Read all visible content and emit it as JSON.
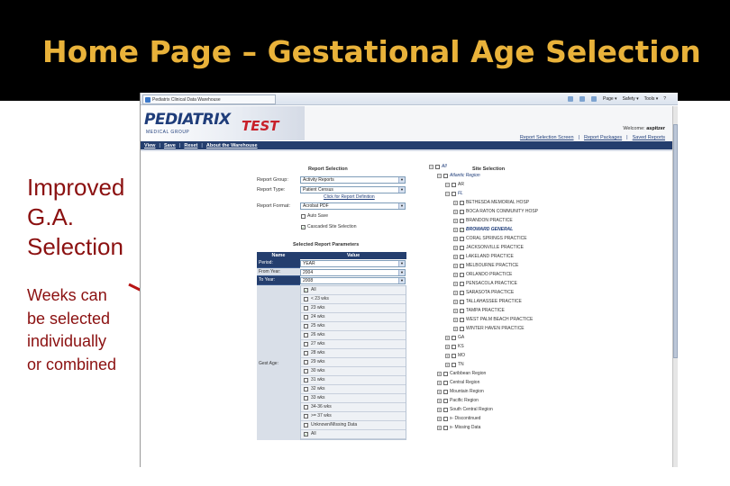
{
  "slide": {
    "title": "Home Page – Gestational Age Selection",
    "caption_big": [
      "Improved",
      "G.A.",
      "Selection"
    ],
    "caption_small": [
      "Weeks can",
      "be selected",
      "individually",
      "or combined"
    ]
  },
  "browser": {
    "tab_title": "Pediatrix Clinical Data Warehouse",
    "tools": [
      "Page ▾",
      "Safety ▾",
      "Tools ▾",
      "?"
    ]
  },
  "app": {
    "logo": "PEDIATRIX",
    "logo_sub": "MEDICAL GROUP",
    "env_label": "TEST",
    "welcome_label": "Welcome:",
    "welcome_user": "aspitzer",
    "header_links": [
      "Report Selection Screen",
      "Report Packages",
      "Saved Reports"
    ],
    "nav": [
      "View",
      "Save",
      "Reset",
      "About the Warehouse"
    ]
  },
  "report_selection": {
    "heading": "Report Selection",
    "group_label": "Report Group:",
    "group_value": "Activity Reports",
    "type_label": "Report Type:",
    "type_value": "Patient Census",
    "definition_link": "Click for Report Definition",
    "format_label": "Report Format:",
    "format_value": "Acrobat PDF",
    "auto_save": "Auto Save",
    "cascaded": "Cascaded Site Selection"
  },
  "parameters": {
    "heading": "Selected Report Parameters",
    "col_name": "Name",
    "col_value": "Value",
    "rows": [
      {
        "name": "Period:",
        "value": "YEAR"
      },
      {
        "name": "From Year:",
        "value": "2004"
      },
      {
        "name": "To Year:",
        "value": "2008"
      }
    ],
    "ga_label": "Gest Age:",
    "ga_options": [
      {
        "label": "All",
        "checked": true
      },
      {
        "label": "< 23 wks",
        "checked": false
      },
      {
        "label": "23 wks",
        "checked": false
      },
      {
        "label": "24 wks",
        "checked": false
      },
      {
        "label": "25 wks",
        "checked": false
      },
      {
        "label": "26 wks",
        "checked": false
      },
      {
        "label": "27 wks",
        "checked": false
      },
      {
        "label": "28 wks",
        "checked": false
      },
      {
        "label": "29 wks",
        "checked": false
      },
      {
        "label": "30 wks",
        "checked": false
      },
      {
        "label": "31 wks",
        "checked": false
      },
      {
        "label": "32 wks",
        "checked": false
      },
      {
        "label": "33 wks",
        "checked": false
      },
      {
        "label": "34-36 wks",
        "checked": false
      },
      {
        "label": ">= 37 wks",
        "checked": false
      },
      {
        "label": "Unknown/Missing Data",
        "checked": false
      },
      {
        "label": "All",
        "checked": true
      }
    ]
  },
  "site_selection": {
    "heading": "Site Selection",
    "items": [
      {
        "label": "All",
        "level": 0,
        "style": "link"
      },
      {
        "label": "Atlantic Region",
        "level": 1,
        "style": "link"
      },
      {
        "label": "AR",
        "level": 2,
        "style": "plain"
      },
      {
        "label": "FL",
        "level": 2,
        "style": "link"
      },
      {
        "label": "BETHESDA MEMORIAL HOSP",
        "level": 3,
        "style": "plain"
      },
      {
        "label": "BOCA RATON COMMUNITY HOSP",
        "level": 3,
        "style": "plain"
      },
      {
        "label": "BRANDON PRACTICE",
        "level": 3,
        "style": "plain"
      },
      {
        "label": "BROWARD GENERAL",
        "level": 3,
        "style": "bold"
      },
      {
        "label": "CORAL SPRINGS PRACTICE",
        "level": 3,
        "style": "plain"
      },
      {
        "label": "JACKSONVILLE PRACTICE",
        "level": 3,
        "style": "plain"
      },
      {
        "label": "LAKELAND PRACTICE",
        "level": 3,
        "style": "plain"
      },
      {
        "label": "MELBOURNE PRACTICE",
        "level": 3,
        "style": "plain"
      },
      {
        "label": "ORLANDO PRACTICE",
        "level": 3,
        "style": "plain"
      },
      {
        "label": "PENSACOLA PRACTICE",
        "level": 3,
        "style": "plain"
      },
      {
        "label": "SARASOTA PRACTICE",
        "level": 3,
        "style": "plain"
      },
      {
        "label": "TALLAHASSEE PRACTICE",
        "level": 3,
        "style": "plain"
      },
      {
        "label": "TAMPA PRACTICE",
        "level": 3,
        "style": "plain"
      },
      {
        "label": "WEST PALM BEACH PRACTICE",
        "level": 3,
        "style": "plain"
      },
      {
        "label": "WINTER HAVEN PRACTICE",
        "level": 3,
        "style": "plain"
      },
      {
        "label": "GA",
        "level": 2,
        "style": "plain"
      },
      {
        "label": "KS",
        "level": 2,
        "style": "plain"
      },
      {
        "label": "MO",
        "level": 2,
        "style": "plain"
      },
      {
        "label": "TN",
        "level": 2,
        "style": "plain"
      },
      {
        "label": "Caribbean Region",
        "level": 1,
        "style": "plain"
      },
      {
        "label": "Central Region",
        "level": 1,
        "style": "plain"
      },
      {
        "label": "Mountain Region",
        "level": 1,
        "style": "plain"
      },
      {
        "label": "Pacific Region",
        "level": 1,
        "style": "plain"
      },
      {
        "label": "South Central Region",
        "level": 1,
        "style": "plain"
      },
      {
        "label": "x- Discontinued",
        "level": 1,
        "style": "plain"
      },
      {
        "label": "x- Missing Data",
        "level": 1,
        "style": "plain"
      }
    ]
  }
}
